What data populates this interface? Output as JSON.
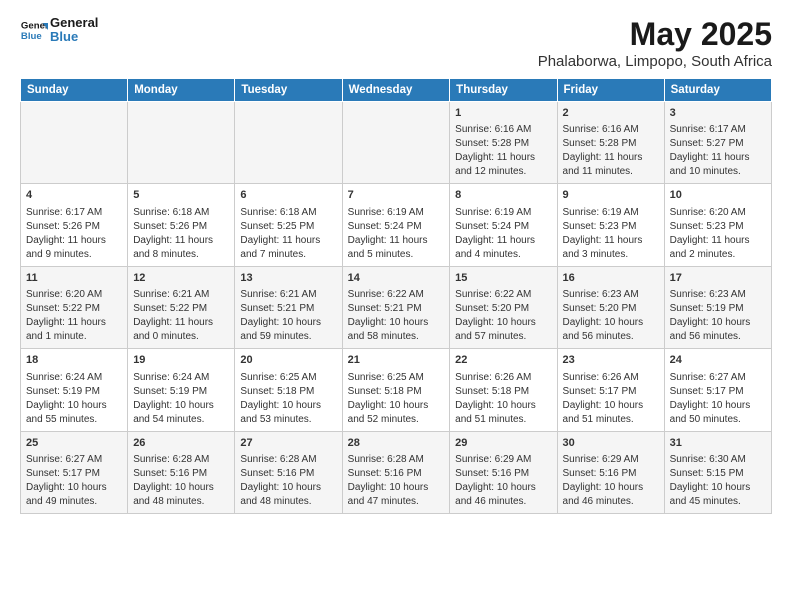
{
  "logo": {
    "line1": "General",
    "line2": "Blue"
  },
  "title": "May 2025",
  "subtitle": "Phalaborwa, Limpopo, South Africa",
  "days_of_week": [
    "Sunday",
    "Monday",
    "Tuesday",
    "Wednesday",
    "Thursday",
    "Friday",
    "Saturday"
  ],
  "weeks": [
    [
      {
        "day": "",
        "content": ""
      },
      {
        "day": "",
        "content": ""
      },
      {
        "day": "",
        "content": ""
      },
      {
        "day": "",
        "content": ""
      },
      {
        "day": "1",
        "content": "Sunrise: 6:16 AM\nSunset: 5:28 PM\nDaylight: 11 hours and 12 minutes."
      },
      {
        "day": "2",
        "content": "Sunrise: 6:16 AM\nSunset: 5:28 PM\nDaylight: 11 hours and 11 minutes."
      },
      {
        "day": "3",
        "content": "Sunrise: 6:17 AM\nSunset: 5:27 PM\nDaylight: 11 hours and 10 minutes."
      }
    ],
    [
      {
        "day": "4",
        "content": "Sunrise: 6:17 AM\nSunset: 5:26 PM\nDaylight: 11 hours and 9 minutes."
      },
      {
        "day": "5",
        "content": "Sunrise: 6:18 AM\nSunset: 5:26 PM\nDaylight: 11 hours and 8 minutes."
      },
      {
        "day": "6",
        "content": "Sunrise: 6:18 AM\nSunset: 5:25 PM\nDaylight: 11 hours and 7 minutes."
      },
      {
        "day": "7",
        "content": "Sunrise: 6:19 AM\nSunset: 5:24 PM\nDaylight: 11 hours and 5 minutes."
      },
      {
        "day": "8",
        "content": "Sunrise: 6:19 AM\nSunset: 5:24 PM\nDaylight: 11 hours and 4 minutes."
      },
      {
        "day": "9",
        "content": "Sunrise: 6:19 AM\nSunset: 5:23 PM\nDaylight: 11 hours and 3 minutes."
      },
      {
        "day": "10",
        "content": "Sunrise: 6:20 AM\nSunset: 5:23 PM\nDaylight: 11 hours and 2 minutes."
      }
    ],
    [
      {
        "day": "11",
        "content": "Sunrise: 6:20 AM\nSunset: 5:22 PM\nDaylight: 11 hours and 1 minute."
      },
      {
        "day": "12",
        "content": "Sunrise: 6:21 AM\nSunset: 5:22 PM\nDaylight: 11 hours and 0 minutes."
      },
      {
        "day": "13",
        "content": "Sunrise: 6:21 AM\nSunset: 5:21 PM\nDaylight: 10 hours and 59 minutes."
      },
      {
        "day": "14",
        "content": "Sunrise: 6:22 AM\nSunset: 5:21 PM\nDaylight: 10 hours and 58 minutes."
      },
      {
        "day": "15",
        "content": "Sunrise: 6:22 AM\nSunset: 5:20 PM\nDaylight: 10 hours and 57 minutes."
      },
      {
        "day": "16",
        "content": "Sunrise: 6:23 AM\nSunset: 5:20 PM\nDaylight: 10 hours and 56 minutes."
      },
      {
        "day": "17",
        "content": "Sunrise: 6:23 AM\nSunset: 5:19 PM\nDaylight: 10 hours and 56 minutes."
      }
    ],
    [
      {
        "day": "18",
        "content": "Sunrise: 6:24 AM\nSunset: 5:19 PM\nDaylight: 10 hours and 55 minutes."
      },
      {
        "day": "19",
        "content": "Sunrise: 6:24 AM\nSunset: 5:19 PM\nDaylight: 10 hours and 54 minutes."
      },
      {
        "day": "20",
        "content": "Sunrise: 6:25 AM\nSunset: 5:18 PM\nDaylight: 10 hours and 53 minutes."
      },
      {
        "day": "21",
        "content": "Sunrise: 6:25 AM\nSunset: 5:18 PM\nDaylight: 10 hours and 52 minutes."
      },
      {
        "day": "22",
        "content": "Sunrise: 6:26 AM\nSunset: 5:18 PM\nDaylight: 10 hours and 51 minutes."
      },
      {
        "day": "23",
        "content": "Sunrise: 6:26 AM\nSunset: 5:17 PM\nDaylight: 10 hours and 51 minutes."
      },
      {
        "day": "24",
        "content": "Sunrise: 6:27 AM\nSunset: 5:17 PM\nDaylight: 10 hours and 50 minutes."
      }
    ],
    [
      {
        "day": "25",
        "content": "Sunrise: 6:27 AM\nSunset: 5:17 PM\nDaylight: 10 hours and 49 minutes."
      },
      {
        "day": "26",
        "content": "Sunrise: 6:28 AM\nSunset: 5:16 PM\nDaylight: 10 hours and 48 minutes."
      },
      {
        "day": "27",
        "content": "Sunrise: 6:28 AM\nSunset: 5:16 PM\nDaylight: 10 hours and 48 minutes."
      },
      {
        "day": "28",
        "content": "Sunrise: 6:28 AM\nSunset: 5:16 PM\nDaylight: 10 hours and 47 minutes."
      },
      {
        "day": "29",
        "content": "Sunrise: 6:29 AM\nSunset: 5:16 PM\nDaylight: 10 hours and 46 minutes."
      },
      {
        "day": "30",
        "content": "Sunrise: 6:29 AM\nSunset: 5:16 PM\nDaylight: 10 hours and 46 minutes."
      },
      {
        "day": "31",
        "content": "Sunrise: 6:30 AM\nSunset: 5:15 PM\nDaylight: 10 hours and 45 minutes."
      }
    ]
  ]
}
